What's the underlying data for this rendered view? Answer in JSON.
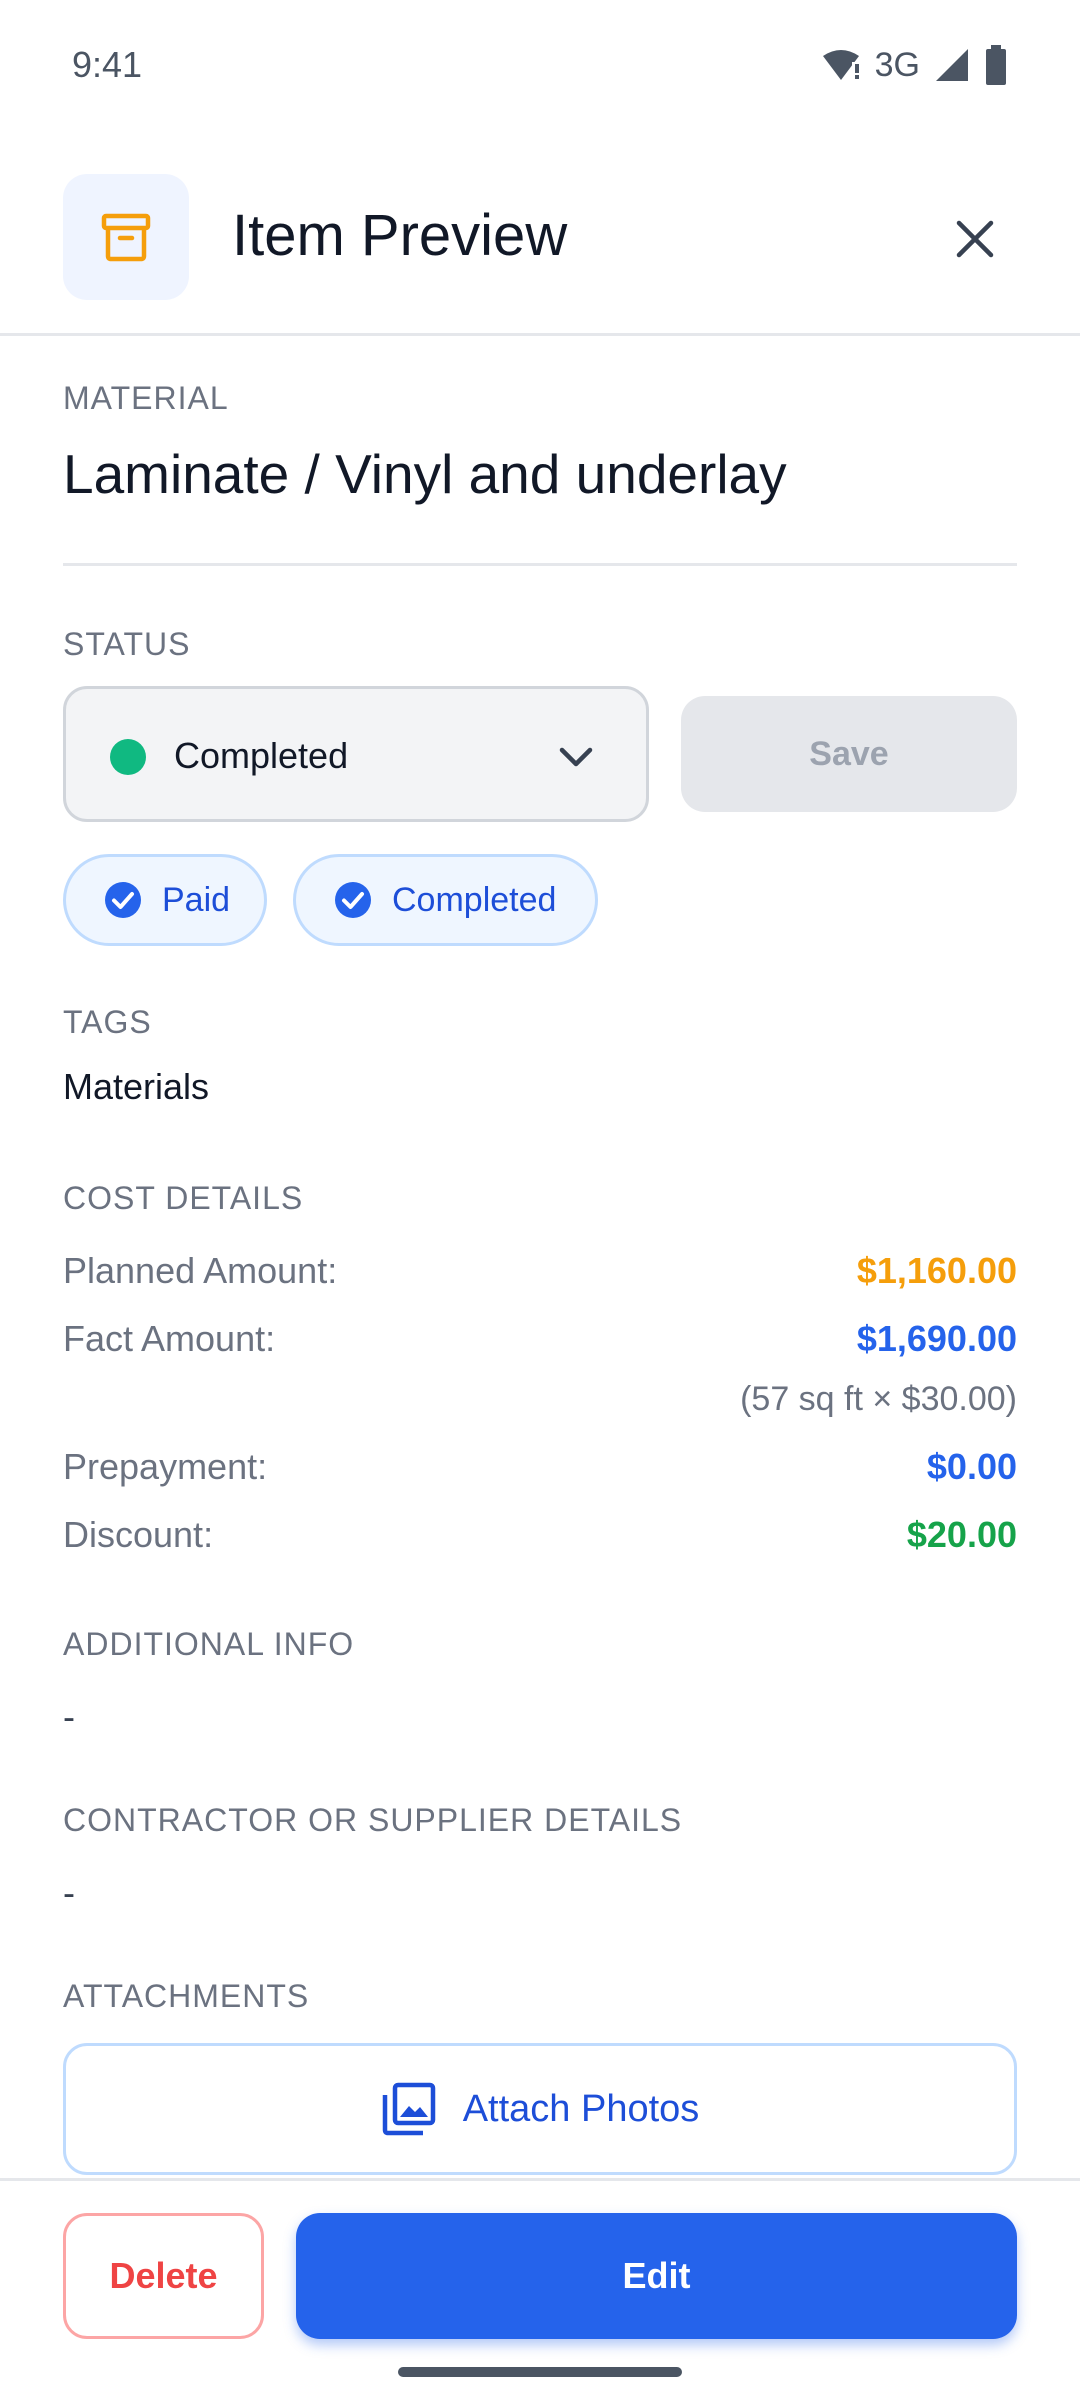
{
  "status_bar": {
    "time": "9:41",
    "network": "3G",
    "icons": [
      "wifi-icon",
      "signal-icon",
      "battery-icon"
    ]
  },
  "header": {
    "title": "Item Preview",
    "icon": "archive-box-icon",
    "close_icon": "close-icon"
  },
  "material": {
    "label": "MATERIAL",
    "name": "Laminate / Vinyl and underlay"
  },
  "status": {
    "label": "STATUS",
    "selected": "Completed",
    "dot_color": "#10b981",
    "save_label": "Save",
    "chips": [
      {
        "label": "Paid",
        "icon": "check-circle-icon"
      },
      {
        "label": "Completed",
        "icon": "check-circle-icon"
      }
    ]
  },
  "tags": {
    "label": "TAGS",
    "value": "Materials"
  },
  "cost": {
    "label": "COST DETAILS",
    "rows": [
      {
        "label": "Planned Amount:",
        "value": "$1,160.00",
        "color": "#f59e0b"
      },
      {
        "label": "Fact Amount:",
        "value": "$1,690.00",
        "color": "#2563eb"
      },
      {
        "label": "Prepayment:",
        "value": "$0.00",
        "color": "#2563eb"
      },
      {
        "label": "Discount:",
        "value": "$20.00",
        "color": "#16a34a"
      }
    ],
    "fact_note": "(57 sq ft × $30.00)"
  },
  "additional_info": {
    "label": "ADDITIONAL INFO",
    "value": "-"
  },
  "contractor": {
    "label": "CONTRACTOR OR SUPPLIER DETAILS",
    "value": "-"
  },
  "attachments": {
    "label": "ATTACHMENTS",
    "button_label": "Attach Photos",
    "icon": "photo-library-icon"
  },
  "actions": {
    "delete_label": "Delete",
    "edit_label": "Edit"
  },
  "colors": {
    "accent": "#2563eb",
    "danger": "#ef4444",
    "success": "#10b981"
  }
}
